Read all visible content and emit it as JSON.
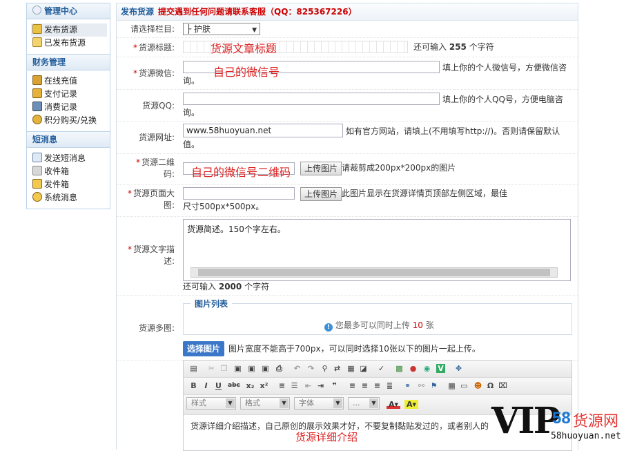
{
  "sidebar": {
    "sections": [
      {
        "title": "管理中心",
        "items": [
          {
            "label": "发布货源"
          },
          {
            "label": "已发布货源"
          }
        ]
      },
      {
        "title": "财务管理",
        "items": [
          {
            "label": "在线充值"
          },
          {
            "label": "支付记录"
          },
          {
            "label": "消费记录"
          },
          {
            "label": "积分购买/兑换"
          }
        ]
      },
      {
        "title": "短消息",
        "items": [
          {
            "label": "发送短消息"
          },
          {
            "label": "收件箱"
          },
          {
            "label": "发件箱"
          },
          {
            "label": "系统消息"
          }
        ]
      }
    ]
  },
  "header": {
    "title": "发布货源",
    "notice": "提交遇到任何问题请联系客服（QQ：825367226）"
  },
  "form": {
    "category": {
      "label": "请选择栏目:",
      "value": "├ 护肤"
    },
    "title": {
      "label": "货源标题:",
      "overlay": "货源文章标题",
      "hint_prefix": "还可输入",
      "hint_count": "255",
      "hint_suffix": "个字符"
    },
    "wechat": {
      "label": "货源微信:",
      "overlay": "自己的微信号",
      "hint": "填上你的个人微信号，方便微信咨询。"
    },
    "qq": {
      "label": "货源QQ:",
      "hint": "填上你的个人QQ号，方便电脑咨询。"
    },
    "website": {
      "label": "货源网址:",
      "value": "www.58huoyuan.net",
      "hint": "如有官方网站，请填上(不用填写http://)。否则请保留默认值。"
    },
    "qrcode": {
      "label_line1": "货源二维",
      "label_line2": "码:",
      "overlay": "自己的微信号二维码",
      "button": "上传图片",
      "hint": "请裁剪成200px*200px的图片"
    },
    "banner": {
      "label_line1": "货源页面大",
      "label_line2": "图:",
      "button": "上传图片",
      "hint": "此图片显示在货源详情页顶部左侧区域，最佳尺寸500px*500px。"
    },
    "description": {
      "label_line1": "货源文字描",
      "label_line2": "述:",
      "value": "货源简述。150个字左右。",
      "hint_prefix": "还可输入",
      "hint_count": "2000",
      "hint_suffix": "个字符"
    },
    "images": {
      "label": "货源多图:",
      "legend": "图片列表",
      "info_prefix": "您最多可以同时上传",
      "info_count": "10",
      "info_suffix": "张",
      "select_button": "选择图片",
      "select_hint": "图片宽度不能高于700px，可以同时选择10张以下的图片一起上传。"
    },
    "editor": {
      "combos": [
        "样式",
        "格式",
        "字体",
        "..."
      ],
      "content": "货源详细介绍描述，自己原创的展示效果才好，不要复制黏贴发过的，或者别人的",
      "overlay": "货源详细介绍"
    }
  },
  "watermark": {
    "brand": "VIP",
    "number": "58",
    "cn": "货源网",
    "url": "58huoyuan.net"
  },
  "colors": {
    "brand_blue": "#1f5b9a",
    "required_red": "#cc0000",
    "overlay_red": "#dd2222",
    "button_blue": "#3a77c9"
  }
}
